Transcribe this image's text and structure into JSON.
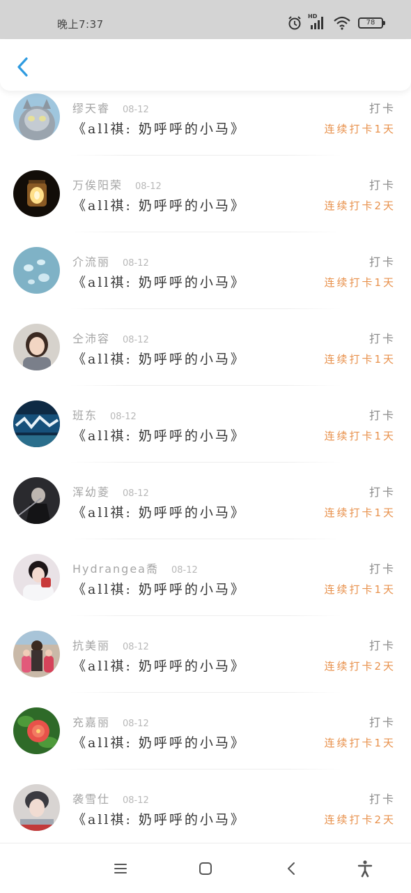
{
  "status_bar": {
    "time": "晚上7:37",
    "battery": "78",
    "icons": [
      "alarm-icon",
      "signal-icon",
      "wifi-icon",
      "battery-icon"
    ]
  },
  "header": {
    "back_icon": "chevron-left-icon"
  },
  "colors": {
    "accent": "#2f9be0",
    "streak": "#e8914c"
  },
  "entries": [
    {
      "name": "缪天睿",
      "date": "08-12",
      "title": "《all祺: 奶呼呼的小马》",
      "action": "打卡",
      "streak": "连续打卡1天",
      "avatar": "cat"
    },
    {
      "name": "万俟阳荣",
      "date": "08-12",
      "title": "《all祺: 奶呼呼的小马》",
      "action": "打卡",
      "streak": "连续打卡2天",
      "avatar": "jar"
    },
    {
      "name": "介流丽",
      "date": "08-12",
      "title": "《all祺: 奶呼呼的小马》",
      "action": "打卡",
      "streak": "连续打卡1天",
      "avatar": "drops"
    },
    {
      "name": "仝沛容",
      "date": "08-12",
      "title": "《all祺: 奶呼呼的小马》",
      "action": "打卡",
      "streak": "连续打卡1天",
      "avatar": "girl"
    },
    {
      "name": "班东",
      "date": "08-12",
      "title": "《all祺: 奶呼呼的小马》",
      "action": "打卡",
      "streak": "连续打卡1天",
      "avatar": "poster"
    },
    {
      "name": "浑幼菱",
      "date": "08-12",
      "title": "《all祺: 奶呼呼的小马》",
      "action": "打卡",
      "streak": "连续打卡1天",
      "avatar": "dark"
    },
    {
      "name": "Hydrangea喬",
      "date": "08-12",
      "title": "《all祺: 奶呼呼的小马》",
      "action": "打卡",
      "streak": "连续打卡1天",
      "avatar": "boy"
    },
    {
      "name": "抗美丽",
      "date": "08-12",
      "title": "《all祺: 奶呼呼的小马》",
      "action": "打卡",
      "streak": "连续打卡2天",
      "avatar": "family"
    },
    {
      "name": "充嘉丽",
      "date": "08-12",
      "title": "《all祺: 奶呼呼的小马》",
      "action": "打卡",
      "streak": "连续打卡1天",
      "avatar": "flower"
    },
    {
      "name": "袭雪仕",
      "date": "08-12",
      "title": "《all祺: 奶呼呼的小马》",
      "action": "打卡",
      "streak": "连续打卡2天",
      "avatar": "portrait"
    }
  ],
  "nav": {
    "icons": [
      "menu-icon",
      "home-icon",
      "back-icon",
      "accessibility-icon"
    ]
  }
}
